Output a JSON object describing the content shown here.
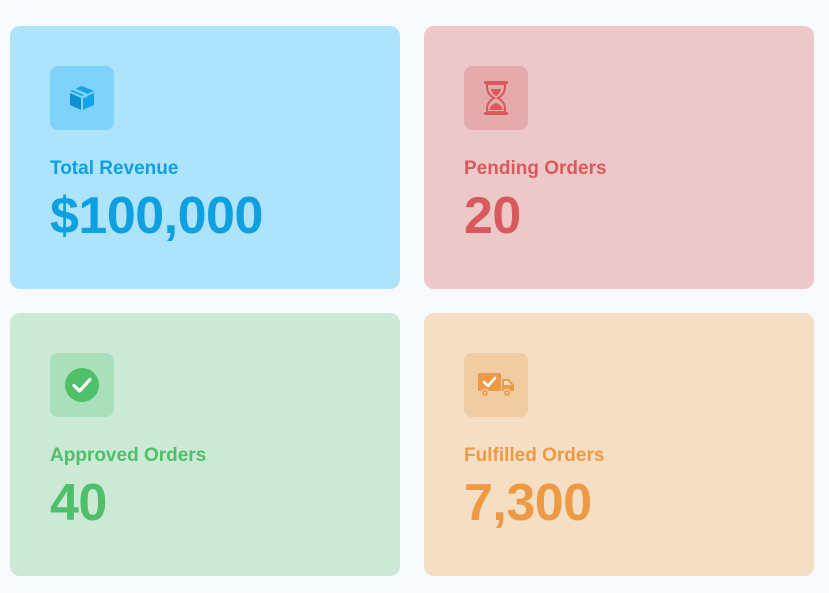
{
  "colors": {
    "page_background": "#f8f9fb",
    "revenue_accent": "#0ea0e0",
    "pending_accent": "#d95a5d",
    "approved_accent": "#4fbf6a",
    "fulfilled_accent": "#ee9a45"
  },
  "cards": [
    {
      "icon": "package-icon",
      "label": "Total Revenue",
      "value": "$100,000"
    },
    {
      "icon": "hourglass-icon",
      "label": "Pending Orders",
      "value": "20"
    },
    {
      "icon": "check-circle-icon",
      "label": "Approved Orders",
      "value": "40"
    },
    {
      "icon": "delivery-truck-icon",
      "label": "Fulfilled Orders",
      "value": "7,300"
    }
  ]
}
